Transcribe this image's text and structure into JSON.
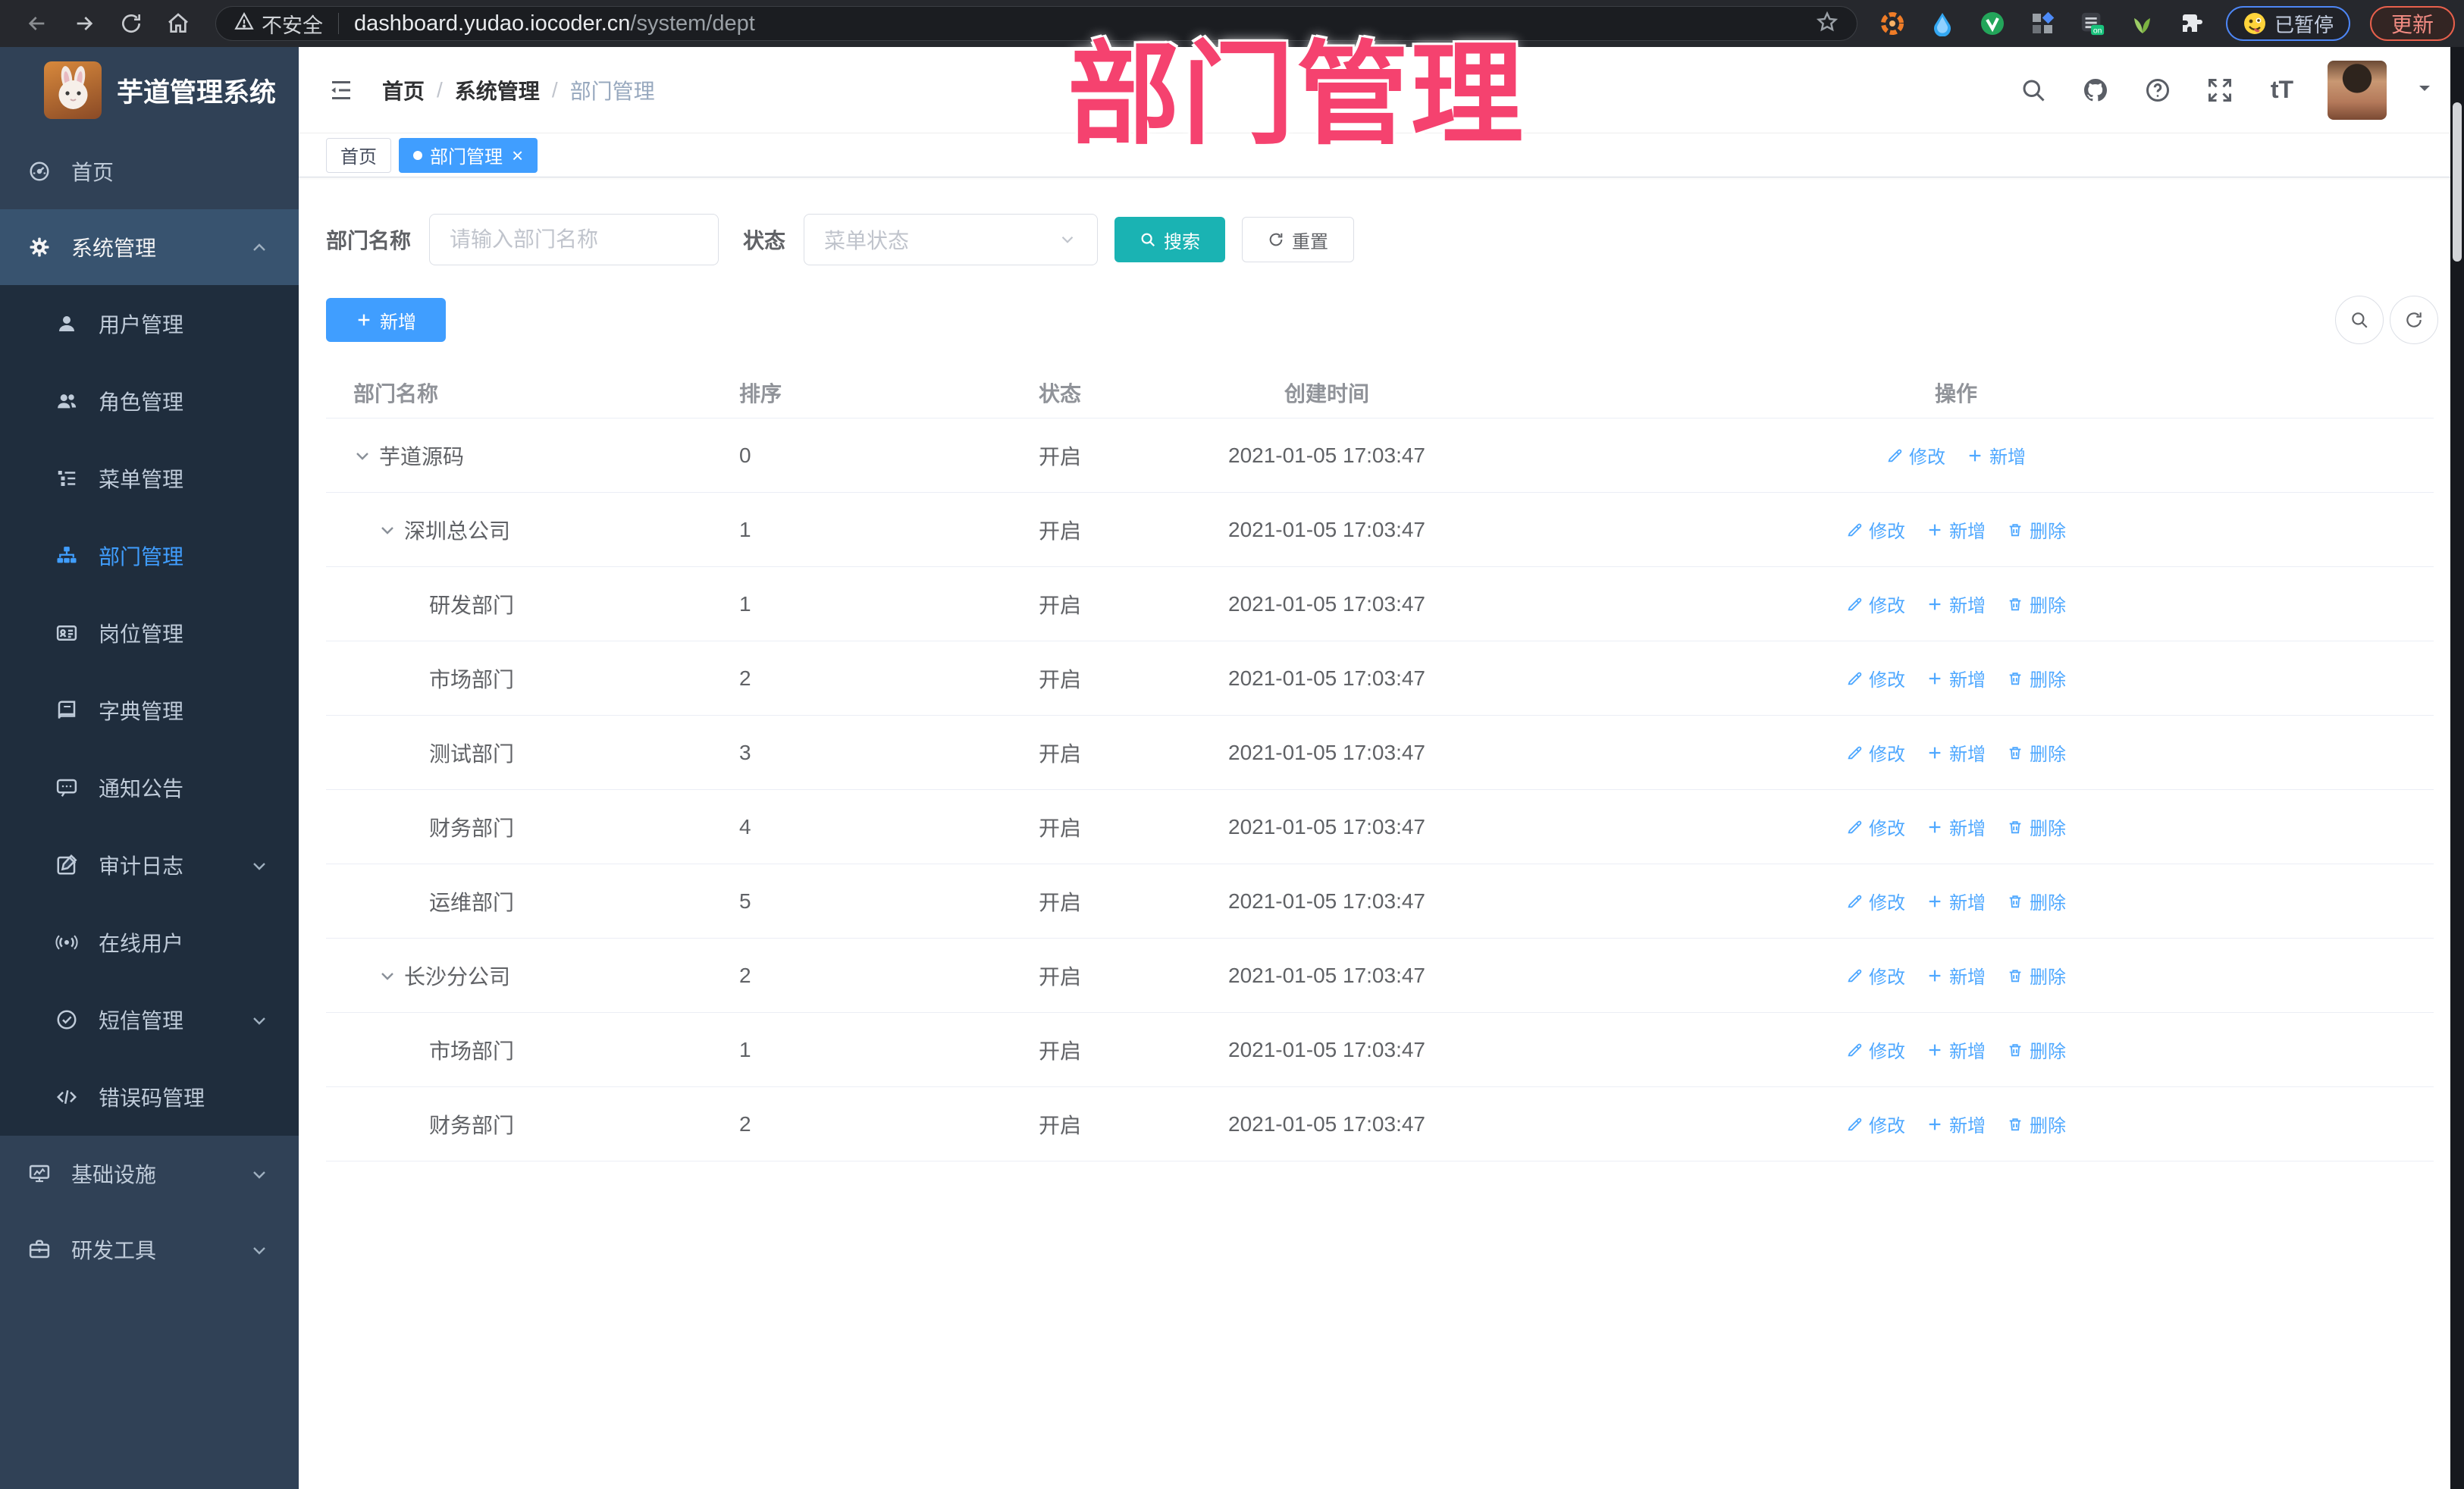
{
  "browser": {
    "security_label": "不安全",
    "url_domain": "dashboard.yudao.iocoder.cn",
    "url_path": "/system/dept",
    "extension_on_badge": "on",
    "paused_label": "已暂停",
    "update_label": "更新"
  },
  "overlay": {
    "text": "部门管理",
    "color": "#F5426F"
  },
  "app": {
    "logo_title": "芋道管理系统",
    "breadcrumb": [
      "首页",
      "系统管理",
      "部门管理"
    ],
    "tabs": [
      {
        "label": "首页",
        "active": false
      },
      {
        "label": "部门管理",
        "active": true
      }
    ],
    "sidebar": {
      "items": [
        {
          "id": "home",
          "label": "首页",
          "icon": "dashboard-icon",
          "type": "top"
        },
        {
          "id": "system-management",
          "label": "系统管理",
          "icon": "gear-icon",
          "type": "top",
          "chevron": "up",
          "highlight": true
        },
        {
          "id": "user-management",
          "label": "用户管理",
          "icon": "user-icon",
          "type": "sub"
        },
        {
          "id": "role-management",
          "label": "角色管理",
          "icon": "users-icon",
          "type": "sub"
        },
        {
          "id": "menu-management",
          "label": "菜单管理",
          "icon": "menu-list-icon",
          "type": "sub"
        },
        {
          "id": "dept-management",
          "label": "部门管理",
          "icon": "org-tree-icon",
          "type": "sub",
          "active": true
        },
        {
          "id": "post-management",
          "label": "岗位管理",
          "icon": "id-card-icon",
          "type": "sub"
        },
        {
          "id": "dict-management",
          "label": "字典管理",
          "icon": "dictionary-icon",
          "type": "sub"
        },
        {
          "id": "notice-announcement",
          "label": "通知公告",
          "icon": "announcement-icon",
          "type": "sub"
        },
        {
          "id": "audit-log",
          "label": "审计日志",
          "icon": "audit-log-icon",
          "type": "sub",
          "chevron": "down"
        },
        {
          "id": "online-users",
          "label": "在线用户",
          "icon": "online-user-icon",
          "type": "sub"
        },
        {
          "id": "sms-management",
          "label": "短信管理",
          "icon": "sms-icon",
          "type": "sub",
          "chevron": "down"
        },
        {
          "id": "error-code-management",
          "label": "错误码管理",
          "icon": "error-code-icon",
          "type": "sub"
        },
        {
          "id": "infrastructure",
          "label": "基础设施",
          "icon": "infrastructure-icon",
          "type": "top",
          "chevron": "down"
        },
        {
          "id": "dev-tools",
          "label": "研发工具",
          "icon": "dev-tools-icon",
          "type": "top",
          "chevron": "down"
        }
      ]
    },
    "search_form": {
      "name_label": "部门名称",
      "name_placeholder": "请输入部门名称",
      "status_label": "状态",
      "status_placeholder": "菜单状态",
      "search_label": "搜索",
      "reset_label": "重置"
    },
    "toolbar": {
      "add_label": "新增"
    },
    "table": {
      "headers": [
        "部门名称",
        "排序",
        "状态",
        "创建时间",
        "操作"
      ],
      "action_labels": {
        "edit": "修改",
        "add": "新增",
        "delete": "删除"
      },
      "rows": [
        {
          "name": "芋道源码",
          "indent": 0,
          "expandable": true,
          "sort": "0",
          "status": "开启",
          "time": "2021-01-05 17:03:47",
          "actions": [
            "edit",
            "add"
          ]
        },
        {
          "name": "深圳总公司",
          "indent": 1,
          "expandable": true,
          "sort": "1",
          "status": "开启",
          "time": "2021-01-05 17:03:47",
          "actions": [
            "edit",
            "add",
            "delete"
          ]
        },
        {
          "name": "研发部门",
          "indent": 2,
          "expandable": false,
          "sort": "1",
          "status": "开启",
          "time": "2021-01-05 17:03:47",
          "actions": [
            "edit",
            "add",
            "delete"
          ]
        },
        {
          "name": "市场部门",
          "indent": 2,
          "expandable": false,
          "sort": "2",
          "status": "开启",
          "time": "2021-01-05 17:03:47",
          "actions": [
            "edit",
            "add",
            "delete"
          ]
        },
        {
          "name": "测试部门",
          "indent": 2,
          "expandable": false,
          "sort": "3",
          "status": "开启",
          "time": "2021-01-05 17:03:47",
          "actions": [
            "edit",
            "add",
            "delete"
          ]
        },
        {
          "name": "财务部门",
          "indent": 2,
          "expandable": false,
          "sort": "4",
          "status": "开启",
          "time": "2021-01-05 17:03:47",
          "actions": [
            "edit",
            "add",
            "delete"
          ]
        },
        {
          "name": "运维部门",
          "indent": 2,
          "expandable": false,
          "sort": "5",
          "status": "开启",
          "time": "2021-01-05 17:03:47",
          "actions": [
            "edit",
            "add",
            "delete"
          ]
        },
        {
          "name": "长沙分公司",
          "indent": 1,
          "expandable": true,
          "sort": "2",
          "status": "开启",
          "time": "2021-01-05 17:03:47",
          "actions": [
            "edit",
            "add",
            "delete"
          ]
        },
        {
          "name": "市场部门",
          "indent": 2,
          "expandable": false,
          "sort": "1",
          "status": "开启",
          "time": "2021-01-05 17:03:47",
          "actions": [
            "edit",
            "add",
            "delete"
          ]
        },
        {
          "name": "财务部门",
          "indent": 2,
          "expandable": false,
          "sort": "2",
          "status": "开启",
          "time": "2021-01-05 17:03:47",
          "actions": [
            "edit",
            "add",
            "delete"
          ]
        }
      ]
    },
    "colors": {
      "accent_blue": "#409EFF",
      "search_teal": "#1AB3B3",
      "action_link_blue": "#4FA8FF",
      "sidebar_bg": "#304156",
      "submenu_bg": "#1F2D3D",
      "overlay_pink": "#F5426F",
      "tag_active_bg": "#409EFF"
    }
  }
}
